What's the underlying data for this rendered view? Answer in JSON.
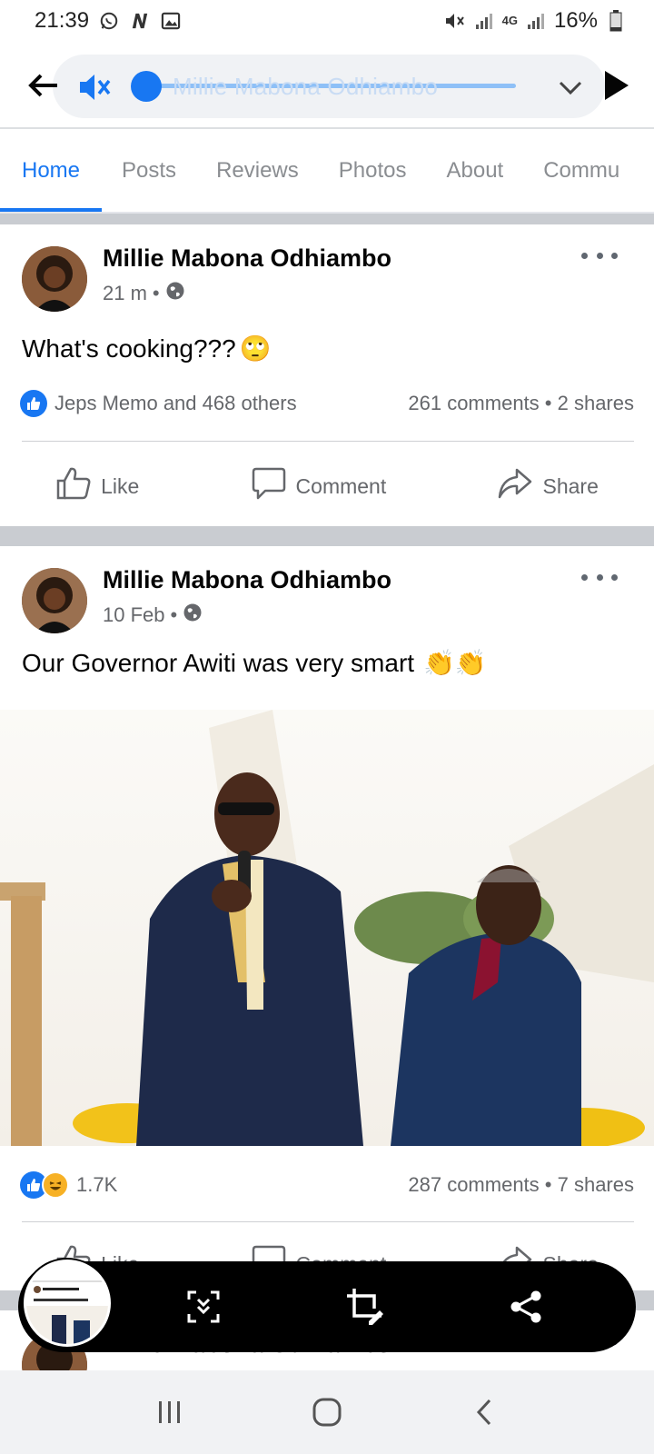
{
  "status_bar": {
    "time": "21:39",
    "battery": "16%",
    "network": "4G",
    "icons": [
      "whatsapp-icon",
      "n-notification-icon",
      "gallery-icon",
      "mute-icon",
      "signal-icon",
      "signal-icon",
      "battery-icon"
    ]
  },
  "topbar": {
    "page_name_faded": "Millie Mabona Odhiambo",
    "icons": [
      "back-arrow-icon",
      "volume-muted-icon",
      "chevron-down-icon",
      "forward-arrow-icon"
    ]
  },
  "tabs": [
    {
      "label": "Home",
      "active": true
    },
    {
      "label": "Posts",
      "active": false
    },
    {
      "label": "Reviews",
      "active": false
    },
    {
      "label": "Photos",
      "active": false
    },
    {
      "label": "About",
      "active": false
    },
    {
      "label": "Commu",
      "active": false
    }
  ],
  "posts": [
    {
      "author": "Millie Mabona Odhiambo",
      "time": "21 m",
      "audience_icon": "globe-icon",
      "text": "What's cooking???",
      "emoji": "🙄",
      "reactions_text": "Jeps Memo and 468 others",
      "comments": "261 comments",
      "shares": "2 shares"
    },
    {
      "author": "Millie Mabona Odhiambo",
      "time": "10 Feb",
      "audience_icon": "globe-icon",
      "text": "Our Governor Awiti was very smart",
      "emoji": "👏👏",
      "reactions_count": "1.7K",
      "comments": "287 comments",
      "shares": "7 shares"
    },
    {
      "author": "Millie Mabona Odhiambo"
    }
  ],
  "actions": {
    "like": "Like",
    "comment": "Comment",
    "share": "Share"
  },
  "screenshot_toolbar": {
    "icons": [
      "scroll-capture-icon",
      "crop-edit-icon",
      "share-icon"
    ]
  },
  "nav_bar": {
    "icons": [
      "recents-icon",
      "home-icon",
      "back-icon"
    ]
  },
  "colors": {
    "facebook_blue": "#1877f2",
    "text_dark": "#050505",
    "text_gray": "#65676b",
    "separator": "#c9ccd1"
  }
}
